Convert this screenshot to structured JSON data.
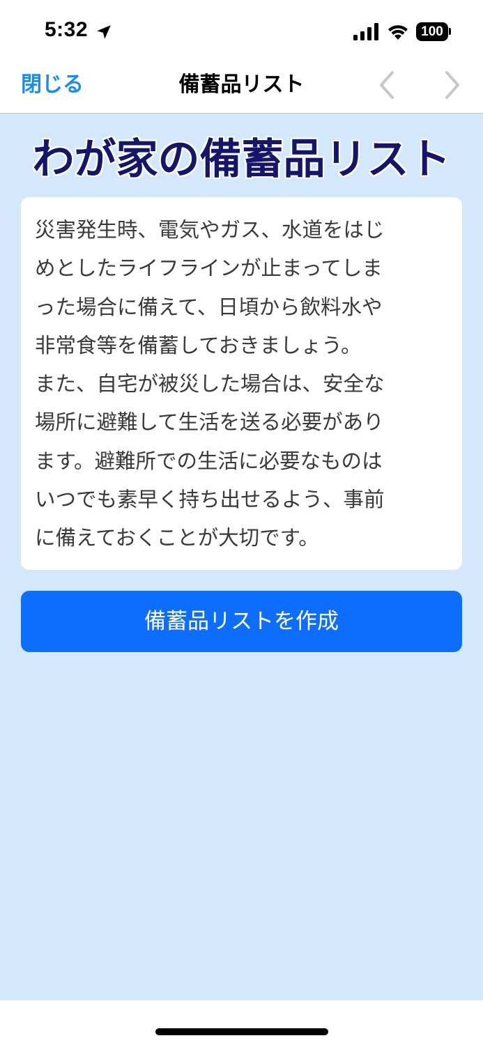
{
  "status_bar": {
    "time": "5:32",
    "battery_level": "100",
    "icons": [
      "location-arrow-icon",
      "cellular-signal-icon",
      "wifi-icon",
      "battery-icon"
    ]
  },
  "nav": {
    "close_label": "閉じる",
    "title": "備蓄品リスト",
    "icons": [
      "chevron-left-icon",
      "chevron-right-icon"
    ]
  },
  "main": {
    "heading": "わが家の備蓄品リスト",
    "description_lines": [
      "災害発生時、電気やガス、水道をはじ",
      "めとしたライフラインが止まってしま",
      "った場合に備えて、日頃から飲料水や",
      "非常食等を備蓄しておきましょう。",
      "また、自宅が被災した場合は、安全な",
      "場所に避難して生活を送る必要があり",
      "ます。避難所での生活に必要なものは",
      "いつでも素早く持ち出せるよう、事前",
      "に備えておくことが大切です。"
    ],
    "create_button_label": "備蓄品リストを作成"
  },
  "colors": {
    "link_blue": "#1a8cf0",
    "content_background": "#d4e8fc",
    "heading_navy": "#15156a",
    "button_blue": "#0d6efd",
    "disabled_chevron": "#c7c7cc"
  }
}
